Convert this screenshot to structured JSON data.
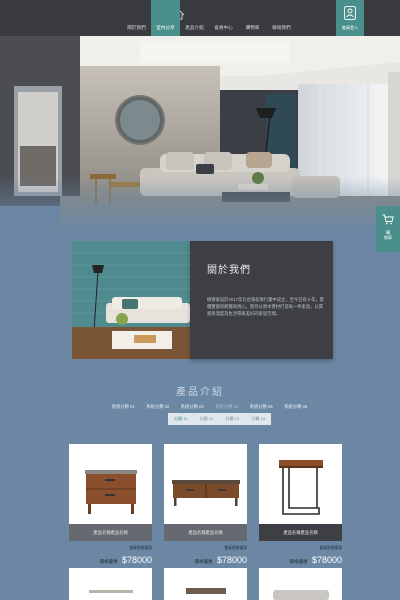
{
  "header": {
    "nav": [
      "關於我們",
      "室內分享",
      "產品介紹",
      "會員中心",
      "購物車",
      "聯絡我們"
    ],
    "active_index": 1,
    "member_label": "會員登入"
  },
  "hero": {
    "slides": 3,
    "active_slide": 0
  },
  "cart": {
    "label_line1": "購",
    "label_line2": "物車"
  },
  "about": {
    "title": "關於我們",
    "text": "樹德家居於2017年在台灣傢俱行業中成立，至今已有十年，累積豐富的經驗與用心，堅持以原木實材打造每一件家具，以質感與溫度為生活帶來美好的家居空間。"
  },
  "products": {
    "title": "產品介紹",
    "series": [
      "系統分類 01",
      "系統分類 02",
      "系統分類 03",
      "系統分類 04",
      "系統分類 05",
      "系統分類 06"
    ],
    "active_series": 3,
    "subseries": [
      "分類 11",
      "分類 12",
      "分類 13",
      "分類 14"
    ],
    "active_sub": 0,
    "cards": [
      {
        "name": "產品名稱產品名稱",
        "tag": "會員價格優惠",
        "price_label": "價格優惠",
        "price": "$78000"
      },
      {
        "name": "產品名稱產品名稱",
        "tag": "會員價格優惠",
        "price_label": "價格優惠",
        "price": "$78000"
      },
      {
        "name": "產品名稱產品名稱",
        "tag": "會員價格優惠",
        "price_label": "價格優惠",
        "price": "$78000"
      }
    ]
  },
  "colors": {
    "accent": "#4b8f8c",
    "page_bg": "#6b87a4",
    "header_bg": "#3a3b3f",
    "panel_bg": "#3d3f44"
  },
  "icons": {
    "logo": "house-logo-icon",
    "member": "user-icon",
    "cart": "cart-icon"
  }
}
